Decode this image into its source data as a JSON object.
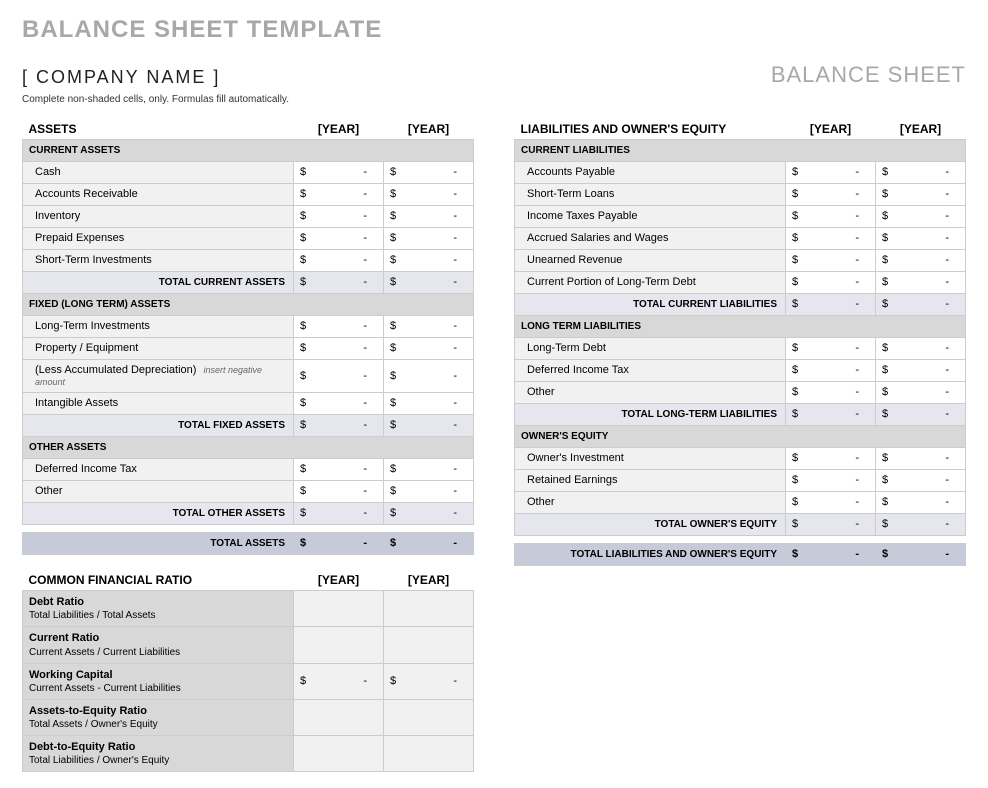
{
  "title": "BALANCE SHEET TEMPLATE",
  "company": "[ COMPANY NAME ]",
  "sheet_title": "BALANCE SHEET",
  "instructions": "Complete non-shaded cells, only. Formulas fill automatically.",
  "year_label": "[YEAR]",
  "dollar": "$",
  "dash": "-",
  "assets": {
    "header": "ASSETS",
    "current": {
      "header": "CURRENT ASSETS",
      "items": [
        "Cash",
        "Accounts Receivable",
        "Inventory",
        "Prepaid Expenses",
        "Short-Term Investments"
      ],
      "total": "TOTAL CURRENT ASSETS"
    },
    "fixed": {
      "header": "FIXED (LONG TERM) ASSETS",
      "items": [
        "Long-Term Investments",
        "Property / Equipment",
        "(Less Accumulated Depreciation)",
        "Intangible Assets"
      ],
      "note": "insert negative amount",
      "total": "TOTAL FIXED ASSETS"
    },
    "other": {
      "header": "OTHER ASSETS",
      "items": [
        "Deferred Income Tax",
        "Other"
      ],
      "total": "TOTAL OTHER ASSETS"
    },
    "grand_total": "TOTAL ASSETS"
  },
  "liabilities": {
    "header": "LIABILITIES AND OWNER'S EQUITY",
    "current": {
      "header": "CURRENT LIABILITIES",
      "items": [
        "Accounts Payable",
        "Short-Term Loans",
        "Income Taxes Payable",
        "Accrued Salaries and Wages",
        "Unearned Revenue",
        "Current Portion of Long-Term Debt"
      ],
      "total": "TOTAL CURRENT LIABILITIES"
    },
    "longterm": {
      "header": "LONG TERM LIABILITIES",
      "items": [
        "Long-Term Debt",
        "Deferred Income Tax",
        "Other"
      ],
      "total": "TOTAL LONG-TERM LIABILITIES"
    },
    "equity": {
      "header": "OWNER'S EQUITY",
      "items": [
        "Owner's Investment",
        "Retained Earnings",
        "Other"
      ],
      "total": "TOTAL OWNER'S EQUITY"
    },
    "grand_total": "TOTAL LIABILITIES AND OWNER'S EQUITY"
  },
  "ratios": {
    "header": "COMMON FINANCIAL RATIO",
    "items": [
      {
        "name": "Debt Ratio",
        "formula": "Total Liabilities / Total Assets",
        "has_value": false
      },
      {
        "name": "Current Ratio",
        "formula": "Current Assets / Current Liabilities",
        "has_value": false
      },
      {
        "name": "Working Capital",
        "formula": "Current Assets - Current Liabilities",
        "has_value": true
      },
      {
        "name": "Assets-to-Equity Ratio",
        "formula": "Total Assets / Owner's Equity",
        "has_value": false
      },
      {
        "name": "Debt-to-Equity Ratio",
        "formula": "Total Liabilities / Owner's Equity",
        "has_value": false
      }
    ]
  }
}
